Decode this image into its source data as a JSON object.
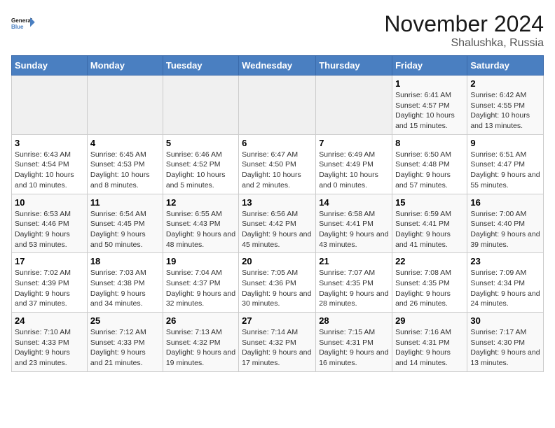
{
  "header": {
    "logo_line1": "General",
    "logo_line2": "Blue",
    "month": "November 2024",
    "location": "Shalushka, Russia"
  },
  "days_of_week": [
    "Sunday",
    "Monday",
    "Tuesday",
    "Wednesday",
    "Thursday",
    "Friday",
    "Saturday"
  ],
  "weeks": [
    [
      {
        "day": "",
        "info": ""
      },
      {
        "day": "",
        "info": ""
      },
      {
        "day": "",
        "info": ""
      },
      {
        "day": "",
        "info": ""
      },
      {
        "day": "",
        "info": ""
      },
      {
        "day": "1",
        "info": "Sunrise: 6:41 AM\nSunset: 4:57 PM\nDaylight: 10 hours and 15 minutes."
      },
      {
        "day": "2",
        "info": "Sunrise: 6:42 AM\nSunset: 4:55 PM\nDaylight: 10 hours and 13 minutes."
      }
    ],
    [
      {
        "day": "3",
        "info": "Sunrise: 6:43 AM\nSunset: 4:54 PM\nDaylight: 10 hours and 10 minutes."
      },
      {
        "day": "4",
        "info": "Sunrise: 6:45 AM\nSunset: 4:53 PM\nDaylight: 10 hours and 8 minutes."
      },
      {
        "day": "5",
        "info": "Sunrise: 6:46 AM\nSunset: 4:52 PM\nDaylight: 10 hours and 5 minutes."
      },
      {
        "day": "6",
        "info": "Sunrise: 6:47 AM\nSunset: 4:50 PM\nDaylight: 10 hours and 2 minutes."
      },
      {
        "day": "7",
        "info": "Sunrise: 6:49 AM\nSunset: 4:49 PM\nDaylight: 10 hours and 0 minutes."
      },
      {
        "day": "8",
        "info": "Sunrise: 6:50 AM\nSunset: 4:48 PM\nDaylight: 9 hours and 57 minutes."
      },
      {
        "day": "9",
        "info": "Sunrise: 6:51 AM\nSunset: 4:47 PM\nDaylight: 9 hours and 55 minutes."
      }
    ],
    [
      {
        "day": "10",
        "info": "Sunrise: 6:53 AM\nSunset: 4:46 PM\nDaylight: 9 hours and 53 minutes."
      },
      {
        "day": "11",
        "info": "Sunrise: 6:54 AM\nSunset: 4:45 PM\nDaylight: 9 hours and 50 minutes."
      },
      {
        "day": "12",
        "info": "Sunrise: 6:55 AM\nSunset: 4:43 PM\nDaylight: 9 hours and 48 minutes."
      },
      {
        "day": "13",
        "info": "Sunrise: 6:56 AM\nSunset: 4:42 PM\nDaylight: 9 hours and 45 minutes."
      },
      {
        "day": "14",
        "info": "Sunrise: 6:58 AM\nSunset: 4:41 PM\nDaylight: 9 hours and 43 minutes."
      },
      {
        "day": "15",
        "info": "Sunrise: 6:59 AM\nSunset: 4:41 PM\nDaylight: 9 hours and 41 minutes."
      },
      {
        "day": "16",
        "info": "Sunrise: 7:00 AM\nSunset: 4:40 PM\nDaylight: 9 hours and 39 minutes."
      }
    ],
    [
      {
        "day": "17",
        "info": "Sunrise: 7:02 AM\nSunset: 4:39 PM\nDaylight: 9 hours and 37 minutes."
      },
      {
        "day": "18",
        "info": "Sunrise: 7:03 AM\nSunset: 4:38 PM\nDaylight: 9 hours and 34 minutes."
      },
      {
        "day": "19",
        "info": "Sunrise: 7:04 AM\nSunset: 4:37 PM\nDaylight: 9 hours and 32 minutes."
      },
      {
        "day": "20",
        "info": "Sunrise: 7:05 AM\nSunset: 4:36 PM\nDaylight: 9 hours and 30 minutes."
      },
      {
        "day": "21",
        "info": "Sunrise: 7:07 AM\nSunset: 4:35 PM\nDaylight: 9 hours and 28 minutes."
      },
      {
        "day": "22",
        "info": "Sunrise: 7:08 AM\nSunset: 4:35 PM\nDaylight: 9 hours and 26 minutes."
      },
      {
        "day": "23",
        "info": "Sunrise: 7:09 AM\nSunset: 4:34 PM\nDaylight: 9 hours and 24 minutes."
      }
    ],
    [
      {
        "day": "24",
        "info": "Sunrise: 7:10 AM\nSunset: 4:33 PM\nDaylight: 9 hours and 23 minutes."
      },
      {
        "day": "25",
        "info": "Sunrise: 7:12 AM\nSunset: 4:33 PM\nDaylight: 9 hours and 21 minutes."
      },
      {
        "day": "26",
        "info": "Sunrise: 7:13 AM\nSunset: 4:32 PM\nDaylight: 9 hours and 19 minutes."
      },
      {
        "day": "27",
        "info": "Sunrise: 7:14 AM\nSunset: 4:32 PM\nDaylight: 9 hours and 17 minutes."
      },
      {
        "day": "28",
        "info": "Sunrise: 7:15 AM\nSunset: 4:31 PM\nDaylight: 9 hours and 16 minutes."
      },
      {
        "day": "29",
        "info": "Sunrise: 7:16 AM\nSunset: 4:31 PM\nDaylight: 9 hours and 14 minutes."
      },
      {
        "day": "30",
        "info": "Sunrise: 7:17 AM\nSunset: 4:30 PM\nDaylight: 9 hours and 13 minutes."
      }
    ]
  ]
}
